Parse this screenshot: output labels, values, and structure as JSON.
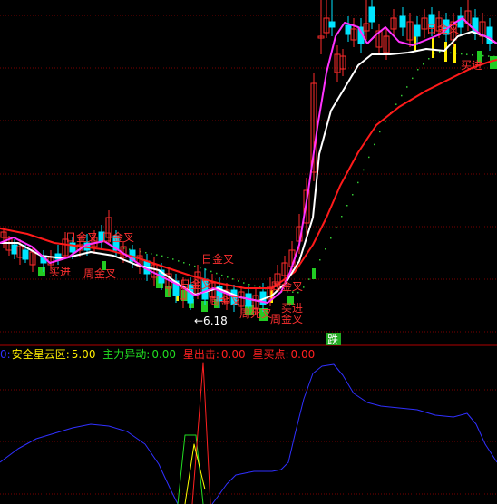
{
  "colors": {
    "background": "#000000",
    "grid": "#7a0000",
    "divider": "#b00000",
    "candle_up": "#ff2b2b",
    "candle_down": "#00e5ff",
    "ma_white": "#ffffff",
    "ma_magenta": "#ff33ff",
    "ma_red": "#ff1a1a",
    "dots": "#33cc33",
    "label_red": "#ff3030",
    "green_bar": "#22cc22",
    "yellow_bar": "#ffee00",
    "blue_line": "#3030ff",
    "ind_green": "#22dd22",
    "ind_red": "#ff2020",
    "ind_yellow": "#ffff00"
  },
  "chart_data": {
    "type": "candlestick",
    "annotations": {
      "golden_cross": [
        "日金叉",
        "日金叉",
        "日金叉",
        "日金叉",
        "日金叉"
      ],
      "weekly_cross": [
        "周金叉",
        "周金叉",
        "周金叉",
        "周金叉"
      ],
      "weekly_dead": "周死叉",
      "buy": [
        "买进",
        "买进",
        "买进"
      ],
      "low_mark": "←6.18",
      "drop_badge": "跌"
    },
    "indicator": {
      "prefix": "0:",
      "items": [
        {
          "label": "安全星云区:",
          "value": "5.00"
        },
        {
          "label": "主力异动:",
          "value": "0.00"
        },
        {
          "label": "星出击:",
          "value": "0.00"
        },
        {
          "label": "星买点:",
          "value": "0.00"
        }
      ]
    }
  }
}
